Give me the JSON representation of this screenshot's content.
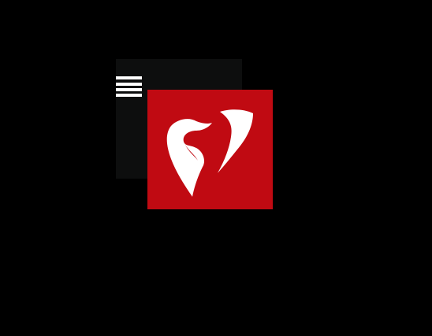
{
  "menu": {
    "icon": "hamburger-menu-icon"
  },
  "logo": {
    "icon": "tooth-logo-icon",
    "background_color": "#c00a12",
    "foreground_color": "#ffffff"
  },
  "colors": {
    "page_background": "#000000",
    "panel_background": "#0d0e0e"
  }
}
